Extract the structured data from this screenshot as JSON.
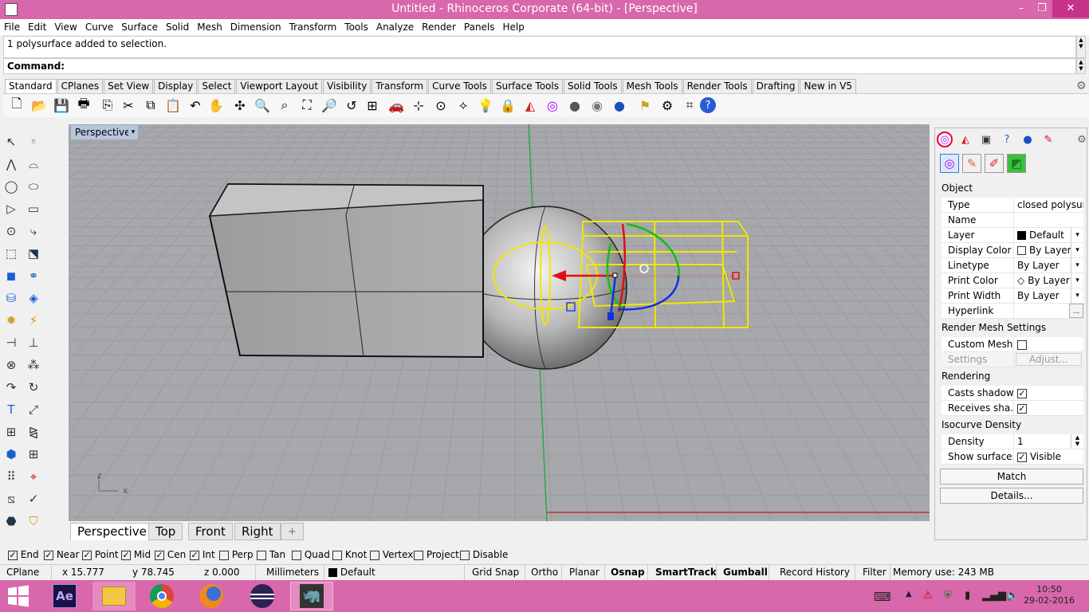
{
  "window": {
    "title": "Untitled - Rhinoceros Corporate (64-bit) - [Perspective]",
    "minimize": "–",
    "maximize": "❐",
    "close": "✕"
  },
  "menu": [
    "File",
    "Edit",
    "View",
    "Curve",
    "Surface",
    "Solid",
    "Mesh",
    "Dimension",
    "Transform",
    "Tools",
    "Analyze",
    "Render",
    "Panels",
    "Help"
  ],
  "command": {
    "history": "1 polysurface added to selection.",
    "prompt": "Command:"
  },
  "toolbar_tabs": [
    "Standard",
    "CPlanes",
    "Set View",
    "Display",
    "Select",
    "Viewport Layout",
    "Visibility",
    "Transform",
    "Curve Tools",
    "Surface Tools",
    "Solid Tools",
    "Mesh Tools",
    "Render Tools",
    "Drafting",
    "New in V5"
  ],
  "viewport": {
    "label": "Perspective",
    "axis_labels": {
      "z": "z",
      "x": "x"
    },
    "tabs": [
      "Perspective",
      "Top",
      "Front",
      "Right"
    ],
    "add_tab": "+"
  },
  "properties": {
    "section_object": "Object",
    "rows": [
      {
        "label": "Type",
        "value": "closed polysurf..."
      },
      {
        "label": "Name",
        "value": ""
      },
      {
        "label": "Layer",
        "value": "Default",
        "swatch": "#000000"
      },
      {
        "label": "Display Color",
        "value": "By Layer",
        "swatch": "#ffffff"
      },
      {
        "label": "Linetype",
        "value": "By Layer"
      },
      {
        "label": "Print Color",
        "value": "By Layer"
      },
      {
        "label": "Print Width",
        "value": "By Layer"
      },
      {
        "label": "Hyperlink",
        "value": "",
        "button": "..."
      }
    ],
    "section_render_mesh": "Render Mesh Settings",
    "custom_mesh": {
      "label": "Custom Mesh",
      "checked": false
    },
    "settings": {
      "label": "Settings",
      "button": "Adjust..."
    },
    "section_rendering": "Rendering",
    "casts_shadows": {
      "label": "Casts shadows",
      "checked": true
    },
    "receives_shadows": {
      "label": "Receives sha...",
      "checked": true
    },
    "section_isocurve": "Isocurve Density",
    "density": {
      "label": "Density",
      "value": "1"
    },
    "show_surface": {
      "label": "Show surface...",
      "value": "Visible",
      "checked": true
    },
    "match_button": "Match",
    "details_button": "Details..."
  },
  "osnaps": [
    {
      "label": "End",
      "checked": true
    },
    {
      "label": "Near",
      "checked": true
    },
    {
      "label": "Point",
      "checked": true
    },
    {
      "label": "Mid",
      "checked": true
    },
    {
      "label": "Cen",
      "checked": true
    },
    {
      "label": "Int",
      "checked": true
    },
    {
      "label": "Perp",
      "checked": false
    },
    {
      "label": "Tan",
      "checked": false
    },
    {
      "label": "Quad",
      "checked": false
    },
    {
      "label": "Knot",
      "checked": false
    },
    {
      "label": "Vertex",
      "checked": false
    },
    {
      "label": "Project",
      "checked": false
    },
    {
      "label": "Disable",
      "checked": false
    }
  ],
  "statusbar": {
    "cplane": "CPlane",
    "x": "x 15.777",
    "y": "y 78.745",
    "z": "z 0.000",
    "units": "Millimeters",
    "layer": "Default",
    "grid_snap": "Grid Snap",
    "ortho": "Ortho",
    "planar": "Planar",
    "osnap": "Osnap",
    "smarttrack": "SmartTrack",
    "gumball": "Gumball",
    "record_history": "Record History",
    "filter": "Filter",
    "memory": "Memory use: 243 MB"
  },
  "taskbar": {
    "apps": [
      "windows-start",
      "after-effects",
      "file-explorer",
      "chrome",
      "firefox",
      "eclipse",
      "rhino"
    ],
    "ae_label": "Ae",
    "time": "10:50",
    "date": "29-02-2016"
  },
  "colors": {
    "titlebar": "#d867ab",
    "viewport_bg": "#a7a8ac",
    "selection": "#ffff00",
    "x_axis": "#e01010",
    "y_axis": "#10c010",
    "z_axis": "#1020e0"
  }
}
